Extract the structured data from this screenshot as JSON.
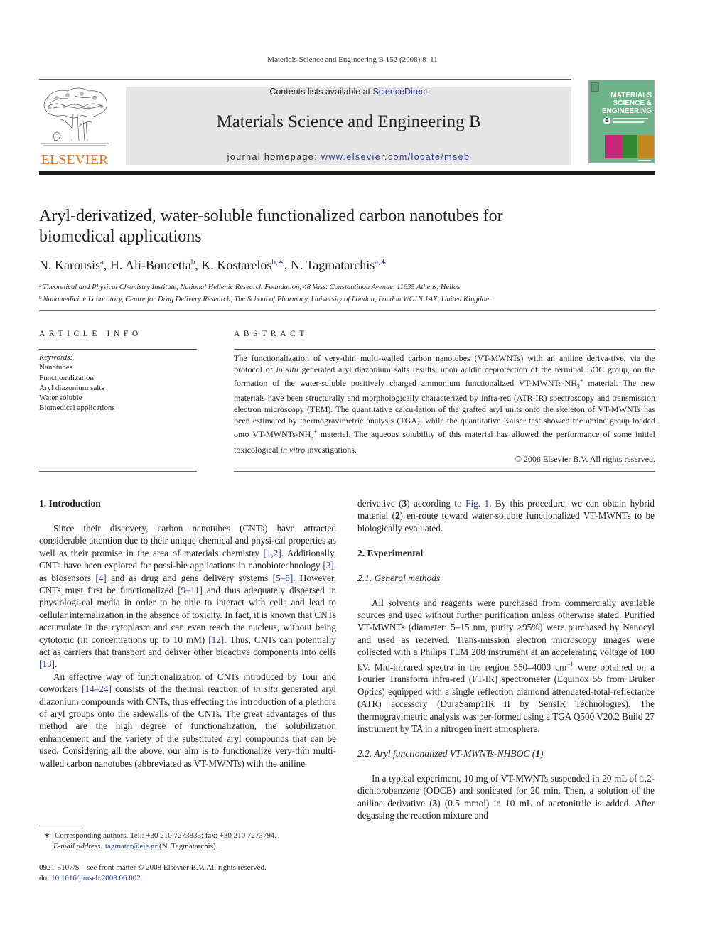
{
  "running_head": "Materials Science and Engineering B 152 (2008) 8–11",
  "masthead": {
    "publisher_wordmark": "ELSEVIER",
    "contents_prefix": "Contents lists available at ",
    "contents_link": "ScienceDirect",
    "journal_title": "Materials Science and Engineering B",
    "homepage_prefix": "journal homepage: ",
    "homepage_link": "www.elsevier.com/locate/mseb",
    "cover": {
      "title_line1": "MATERIALS",
      "title_line2": "SCIENCE &",
      "title_line3": "ENGINEERING",
      "badge": "B",
      "colors": {
        "background": "#6fb48a",
        "panel1": "#c8287a",
        "panel2": "#2f8a2f",
        "panel3": "#c28a1e"
      }
    },
    "accent_color": "#e8792b",
    "link_color": "#2b3a8f"
  },
  "article": {
    "title_line1": "Aryl-derivatized, water-soluble functionalized carbon nanotubes for",
    "title_line2": "biomedical applications",
    "authors": [
      {
        "name": "N. Karousis",
        "sup": "a"
      },
      {
        "name": "H. Ali-Boucetta",
        "sup": "b"
      },
      {
        "name": "K. Kostarelos",
        "sup": "b,∗"
      },
      {
        "name": "N. Tagmatarchis",
        "sup": "a,∗"
      }
    ],
    "affiliations": [
      {
        "mark": "a",
        "text": "Theoretical and Physical Chemistry Institute, National Hellenic Research Foundation, 48 Vass. Constantinou Avenue, 11635 Athens, Hellas"
      },
      {
        "mark": "b",
        "text": "Nanomedicine Laboratory, Centre for Drug Delivery Research, The School of Pharmacy, University of London, London WC1N 1AX, United Kingdom"
      }
    ]
  },
  "article_info": {
    "heading": "ARTICLE INFO",
    "keywords_label": "Keywords:",
    "keywords": [
      "Nanotubes",
      "Functionalization",
      "Aryl diazonium salts",
      "Water soluble",
      "Biomedical applications"
    ]
  },
  "abstract": {
    "heading": "ABSTRACT",
    "p1": "The functionalization of very-thin multi-walled carbon nanotubes (VT-MWNTs) with an aniline deriva-tive, via the protocol of ",
    "p1_italic": "in situ",
    "p2": " generated aryl diazonium salts results, upon acidic deprotection of the terminal BOC group, on the formation of the water-soluble positively charged ammonium functionalized VT-MWNTs-NH",
    "p3": " material. The new materials have been structurally and morphologically characterized by infra-red (ATR-IR) spectroscopy and transmission electron microscopy (TEM). The quantitative calcu-lation of the grafted aryl units onto the skeleton of VT-MWNTs has been estimated by thermogravimetric analysis (TGA), while the quantitative Kaiser test showed the amine group loaded onto VT-MWNTs-NH",
    "p4": " material. The aqueous solubility of this material has allowed the performance of some initial toxicological ",
    "p4_italic": "in vitro",
    "p5": " investigations.",
    "sub3": "3",
    "supplus": "+",
    "copyright": "© 2008 Elsevier B.V. All rights reserved."
  },
  "body": {
    "intro_heading": "1.  Introduction",
    "intro_p1": {
      "a": "Since their discovery, carbon nanotubes (CNTs) have attracted considerable attention due to their unique chemical and physi-cal properties as well as their promise in the area of materials chemistry ",
      "r1": "[1,2]",
      "b": ". Additionally, CNTs have been explored for possi-ble applications in nanobiotechnology ",
      "r2": "[3]",
      "c": ", as biosensors ",
      "r3": "[4]",
      "d": " and as drug and gene delivery systems ",
      "r4": "[5–8]",
      "e": ". However, CNTs must first be functionalized ",
      "r5": "[9–11]",
      "f": " and thus adequately dispersed in physiologi-cal media in order to be able to interact with cells and lead to cellular internalization in the absence of toxicity. In fact, it is known that CNTs accumulate in the cytoplasm and can even reach the nucleus, without being cytotoxic (in concentrations up to 10 mM) ",
      "r6": "[12]",
      "g": ". Thus, CNTs can potentially act as carriers that transport and deliver other bioactive components into cells ",
      "r7": "[13]",
      "h": "."
    },
    "intro_p2": {
      "a": "An effective way of functionalization of CNTs introduced by Tour and coworkers ",
      "r1": "[14–24]",
      "b": " consists of the thermal reaction of ",
      "i1": "in situ",
      "c": " generated aryl diazonium compounds with CNTs, thus effecting the introduction of a plethora of aryl groups onto the sidewalls of the CNTs. The great advantages of this method are the high degree of functionalization, the solubilization enhancement and the variety of the substituted aryl compounds that can be used. Considering all the above, our aim is to functionalize very-thin multi-walled carbon nanotubes (abbreviated as VT-MWNTs) with the aniline"
    },
    "right_p0": {
      "a": "derivative (",
      "b1": "3",
      "b": ") according to ",
      "fig": "Fig. 1",
      "c": ". By this procedure, we can obtain hybrid material (",
      "b2": "2",
      "d": ") en-route toward water-soluble functionalized VT-MWNTs to be biologically evaluated."
    },
    "exp_heading": "2.  Experimental",
    "sub21_heading": "2.1.  General methods",
    "methods_p": {
      "a": "All solvents and reagents were purchased from commercially available sources and used without further purification unless otherwise stated. Purified VT-MWNTs (diameter: 5–15 nm, purity >95%) were purchased by Nanocyl and used as received. Trans-mission electron microscopy images were collected with a Philips TEM 208 instrument at an accelerating voltage of 100 kV. Mid-infrared spectra in the region 550–4000 cm",
      "sup": "−1",
      "b": " were obtained on a Fourier Transform infra-red (FT-IR) spectrometer (Equinox 55 from Bruker Optics) equipped with a single reflection diamond attenuated-total-reflectance (ATR) accessory (DuraSamp1IR II by SensIR Technologies). The thermogravimetric analysis was per-formed using a TGA Q500 V20.2 Build 27 instrument by TA in a nitrogen inert atmosphere."
    },
    "sub22_heading_a": "2.2.  Aryl functionalized VT-MWNTs-NHBOC (",
    "sub22_heading_b": "1",
    "sub22_heading_c": ")",
    "exp_p": {
      "a": "In a typical experiment, 10 mg of VT-MWNTs suspended in 20 mL of 1,2-dichlorobenzene (ODCB) and sonicated for 20 min. Then, a solution of the aniline derivative (",
      "b": "3",
      "c": ") (0.5 mmol) in 10 mL of acetonitrile is added. After degassing the reaction mixture and"
    }
  },
  "footnotes": {
    "star": "∗",
    "corresponding": "Corresponding authors. Tel.: +30 210 7273835; fax: +30 210 7273794.",
    "email_label": "E-mail address: ",
    "email": "tagmatar@eie.gr",
    "email_suffix": " (N. Tagmatarchis).",
    "issn": "0921-5107/$ – see front matter © 2008 Elsevier B.V. All rights reserved.",
    "doi_prefix": "doi:",
    "doi": "10.1016/j.mseb.2008.06.002"
  }
}
